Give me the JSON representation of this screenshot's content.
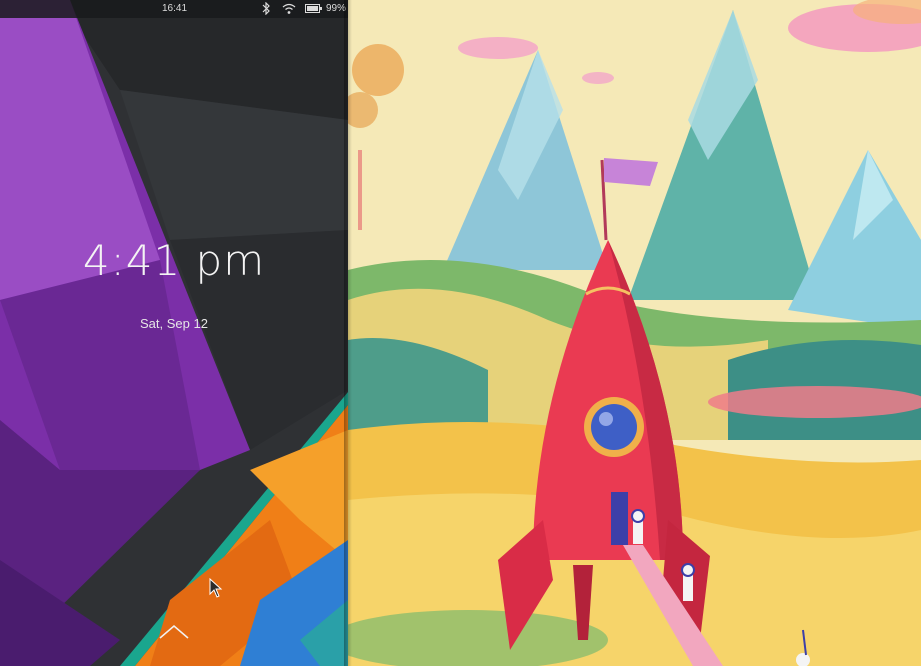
{
  "status_bar": {
    "time": "16:41",
    "battery_percent": "99%",
    "icons": [
      "bluetooth-icon",
      "wifi-icon",
      "battery-icon"
    ]
  },
  "lockscreen": {
    "clock": "4:41 pm",
    "date": "Sat, Sep 12"
  },
  "colors": {
    "purple": "#8d3fb0",
    "orange": "#f08a1a",
    "teal": "#2aa79b",
    "rocket_red": "#e83a4f",
    "sky": "#f5e9b7"
  }
}
